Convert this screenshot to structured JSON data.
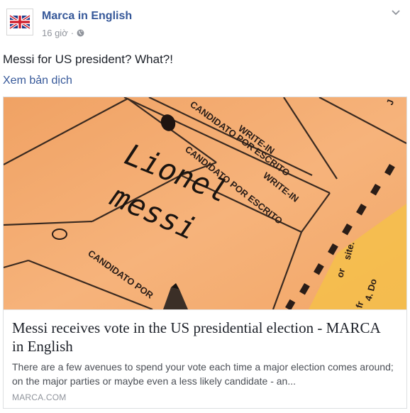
{
  "header": {
    "page_name": "Marca in English",
    "timestamp": "16 giờ",
    "separator": "·",
    "privacy_icon": "globe-icon",
    "options_icon": "chevron-down-icon"
  },
  "post": {
    "text": "Messi for US president? What?!",
    "translate_label": "Xem bản dịch"
  },
  "link_card": {
    "image_text": {
      "handwritten_line1": "Lionel",
      "handwritten_line2": "messi",
      "write_in_1": "WRITE-IN",
      "candidato_1": "CANDIDATO POR ESCRITO",
      "write_in_2": "WRITE-IN",
      "candidato_2": "CANDIDATO POR ESCRITO",
      "candidato_3": "CANDIDATO POR",
      "site": "site.",
      "or": "or",
      "item4": "4. Do",
      "fr": "fr",
      "corner": "J"
    },
    "title": "Messi receives vote in the US presidential election - MARCA in English",
    "description": "There are a few avenues to spend your vote each time a major election comes around; on the major parties or maybe even a less likely candidate - an...",
    "domain": "MARCA.COM"
  },
  "colors": {
    "link_blue": "#365899",
    "text_dark": "#1d2129",
    "meta_gray": "#90949c",
    "ballot_orange": "#f4a768"
  }
}
